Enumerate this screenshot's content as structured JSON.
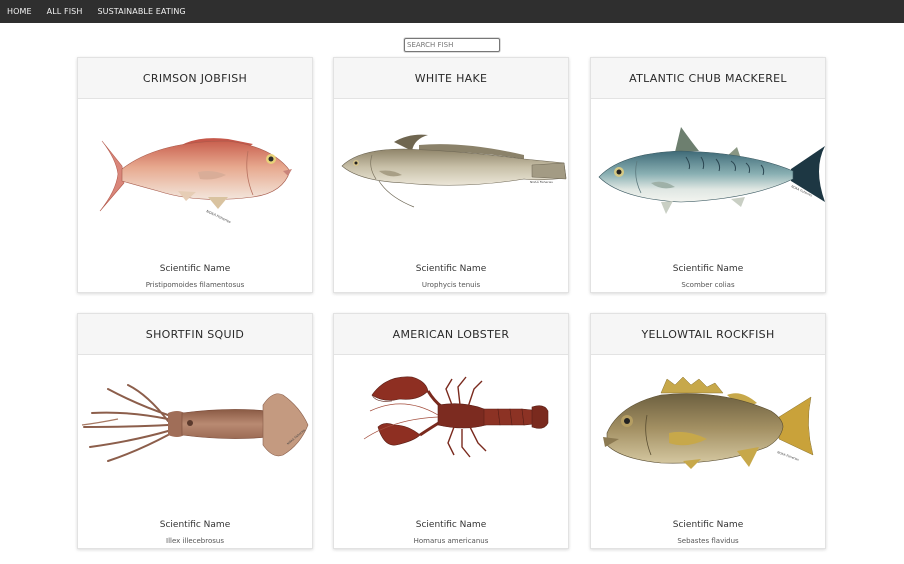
{
  "nav": {
    "items": [
      {
        "label": "HOME"
      },
      {
        "label": "ALL FISH"
      },
      {
        "label": "SUSTAINABLE EATING"
      }
    ]
  },
  "search": {
    "placeholder": "SEARCH FISH"
  },
  "cards": [
    {
      "title": "CRIMSON JOBFISH",
      "sci_label": "Scientific Name",
      "scientific_name": "Pristipomoides filamentosus",
      "credit": "NOAA Fisheries"
    },
    {
      "title": "WHITE HAKE",
      "sci_label": "Scientific Name",
      "scientific_name": "Urophycis tenuis",
      "credit": "NOAA Fisheries"
    },
    {
      "title": "ATLANTIC CHUB MACKEREL",
      "sci_label": "Scientific Name",
      "scientific_name": "Scomber colias",
      "credit": "NOAA Fisheries"
    },
    {
      "title": "SHORTFIN SQUID",
      "sci_label": "Scientific Name",
      "scientific_name": "Illex illecebrosus",
      "credit": "NOAA Fisheries"
    },
    {
      "title": "AMERICAN LOBSTER",
      "sci_label": "Scientific Name",
      "scientific_name": "Homarus americanus",
      "credit": ""
    },
    {
      "title": "YELLOWTAIL ROCKFISH",
      "sci_label": "Scientific Name",
      "scientific_name": "Sebastes flavidus",
      "credit": "NOAA Fisheries"
    }
  ]
}
